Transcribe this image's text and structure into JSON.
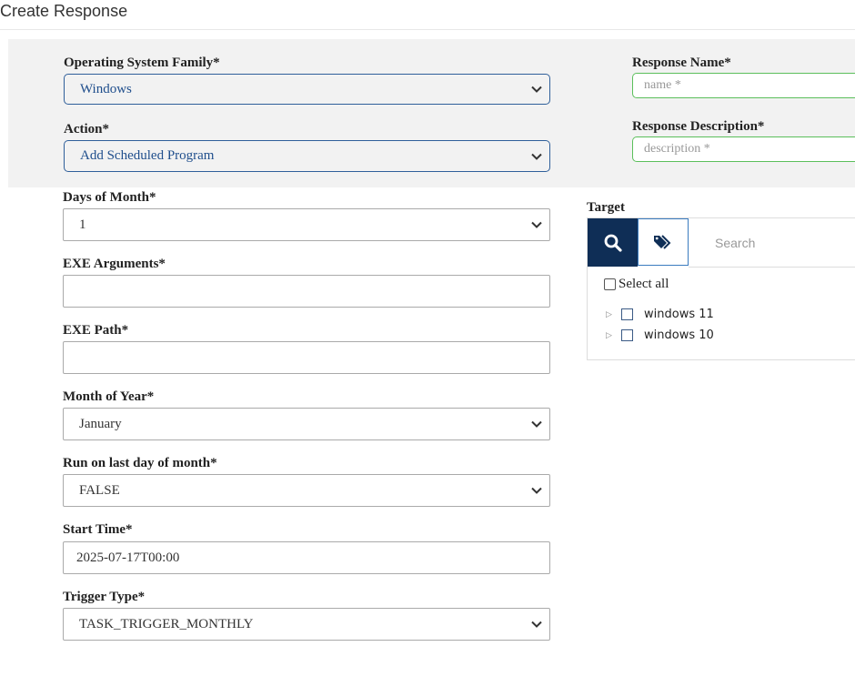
{
  "page": {
    "title": "Create Response"
  },
  "os_family": {
    "label": "Operating System Family*",
    "value": "Windows"
  },
  "action": {
    "label": "Action*",
    "value": "Add Scheduled Program"
  },
  "response_name": {
    "label": "Response Name*",
    "placeholder": "name *"
  },
  "response_description": {
    "label": "Response Description*",
    "placeholder": "description *"
  },
  "days_of_month": {
    "label": "Days of Month*",
    "value": "1"
  },
  "exe_arguments": {
    "label": "EXE Arguments*",
    "value": ""
  },
  "exe_path": {
    "label": "EXE Path*",
    "value": ""
  },
  "month_of_year": {
    "label": "Month of Year*",
    "value": "January"
  },
  "run_last_day": {
    "label": "Run on last day of month*",
    "value": "FALSE"
  },
  "start_time": {
    "label": "Start Time*",
    "value": "2025-07-17T00:00"
  },
  "trigger_type": {
    "label": "Trigger Type*",
    "value": "TASK_TRIGGER_MONTHLY"
  },
  "target": {
    "label": "Target",
    "search_placeholder": "Search",
    "select_all_label": "Select all",
    "items": [
      {
        "label": "windows 11"
      },
      {
        "label": "windows 10"
      }
    ]
  },
  "icons": {
    "search": "search-icon",
    "tags": "tags-icon",
    "chevron": "chevron-down-icon",
    "expand": "triangle-right-icon"
  },
  "colors": {
    "accent_dark": "#0f2e56",
    "select_border_blue": "#2f5f9a",
    "field_border_green": "#5bbf5b",
    "panel_bg": "#f2f2f2"
  }
}
